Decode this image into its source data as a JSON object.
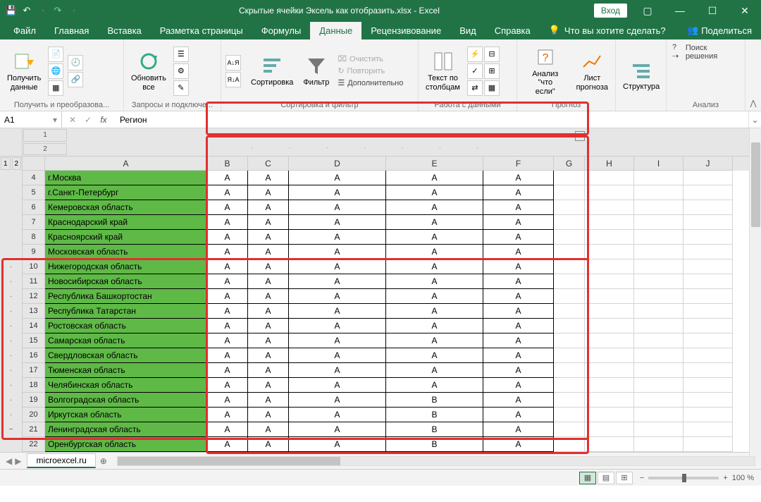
{
  "title": "Скрытые ячейки Эксель как отобразить.xlsx - Excel",
  "login": "Вход",
  "menu": {
    "file": "Файл",
    "home": "Главная",
    "insert": "Вставка",
    "layout": "Разметка страницы",
    "formulas": "Формулы",
    "data": "Данные",
    "review": "Рецензивование",
    "view": "Вид",
    "help": "Справка",
    "tell": "Что вы хотите сделать?",
    "share": "Поделиться"
  },
  "ribbon": {
    "g1": {
      "getdata": "Получить\nданные",
      "label": "Получить и преобразова..."
    },
    "g2": {
      "refresh": "Обновить\nвсе",
      "label": "Запросы и подключе..."
    },
    "g3": {
      "sort": "Сортировка",
      "filter": "Фильтр",
      "clear": "Очистить",
      "reapply": "Повторить",
      "advanced": "Дополнительно",
      "label": "Сортировка и фильтр"
    },
    "g4": {
      "t2c": "Текст по\nстолбцам",
      "label": "Работа с данными"
    },
    "g5": {
      "whatif": "Анализ \"что\nесли\"",
      "forecast": "Лист\nпрогноза",
      "label": "Прогноз"
    },
    "g6": {
      "outline": "Структура",
      "label": ""
    },
    "g7": {
      "solver": "Поиск решения",
      "label": "Анализ"
    }
  },
  "namebox": "A1",
  "formula": "Регион",
  "outline_levels": [
    "1",
    "2"
  ],
  "cols": [
    "A",
    "B",
    "C",
    "D",
    "E",
    "F",
    "G",
    "H",
    "I",
    "J"
  ],
  "rows": [
    {
      "n": 4,
      "o": "",
      "a": "г.Москва",
      "v": [
        "A",
        "A",
        "A",
        "A",
        "A"
      ]
    },
    {
      "n": 5,
      "o": "",
      "a": "г.Санкт-Петербург",
      "v": [
        "A",
        "A",
        "A",
        "A",
        "A"
      ]
    },
    {
      "n": 6,
      "o": "",
      "a": "Кемеровская область",
      "v": [
        "A",
        "A",
        "A",
        "A",
        "A"
      ]
    },
    {
      "n": 7,
      "o": "",
      "a": "Краснодарский край",
      "v": [
        "A",
        "A",
        "A",
        "A",
        "A"
      ]
    },
    {
      "n": 8,
      "o": "",
      "a": "Красноярский край",
      "v": [
        "A",
        "A",
        "A",
        "A",
        "A"
      ]
    },
    {
      "n": 9,
      "o": "",
      "a": "Московская область",
      "v": [
        "A",
        "A",
        "A",
        "A",
        "A"
      ]
    },
    {
      "n": 10,
      "o": "·",
      "a": "Нижегородская область",
      "v": [
        "A",
        "A",
        "A",
        "A",
        "A"
      ]
    },
    {
      "n": 11,
      "o": "·",
      "a": "Новосибирская область",
      "v": [
        "A",
        "A",
        "A",
        "A",
        "A"
      ]
    },
    {
      "n": 12,
      "o": "·",
      "a": "Республика Башкортостан",
      "v": [
        "A",
        "A",
        "A",
        "A",
        "A"
      ]
    },
    {
      "n": 13,
      "o": "·",
      "a": "Республика Татарстан",
      "v": [
        "A",
        "A",
        "A",
        "A",
        "A"
      ]
    },
    {
      "n": 14,
      "o": "·",
      "a": "Ростовская область",
      "v": [
        "A",
        "A",
        "A",
        "A",
        "A"
      ]
    },
    {
      "n": 15,
      "o": "·",
      "a": "Самарская область",
      "v": [
        "A",
        "A",
        "A",
        "A",
        "A"
      ]
    },
    {
      "n": 16,
      "o": "·",
      "a": "Свердловская область",
      "v": [
        "A",
        "A",
        "A",
        "A",
        "A"
      ]
    },
    {
      "n": 17,
      "o": "·",
      "a": "Тюменская область",
      "v": [
        "A",
        "A",
        "A",
        "A",
        "A"
      ]
    },
    {
      "n": 18,
      "o": "·",
      "a": "Челябинская область",
      "v": [
        "A",
        "A",
        "A",
        "A",
        "A"
      ]
    },
    {
      "n": 19,
      "o": "·",
      "a": "Волгоградская область",
      "v": [
        "A",
        "A",
        "A",
        "B",
        "A"
      ]
    },
    {
      "n": 20,
      "o": "·",
      "a": "Иркутская область",
      "v": [
        "A",
        "A",
        "A",
        "B",
        "A"
      ]
    },
    {
      "n": 21,
      "o": "−",
      "a": "Ленинградская область",
      "v": [
        "A",
        "A",
        "A",
        "B",
        "A"
      ]
    },
    {
      "n": 22,
      "o": "",
      "a": "Оренбургская область",
      "v": [
        "A",
        "A",
        "A",
        "B",
        "A"
      ]
    }
  ],
  "sheet_tab": "microexcel.ru",
  "zoom": "100 %"
}
